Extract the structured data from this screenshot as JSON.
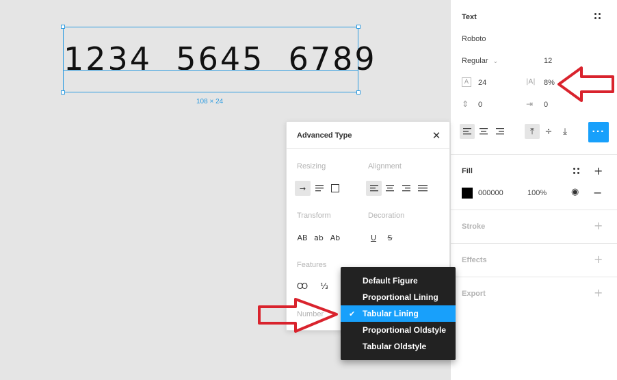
{
  "canvas": {
    "sample_text": "1234  5645  6789",
    "size_label": "108 × 24"
  },
  "text_section": {
    "title": "Text",
    "font_family": "Roboto",
    "font_style": "Regular",
    "font_size": "12",
    "line_height": "24",
    "letter_spacing": "8%",
    "paragraph_spacing": "0",
    "paragraph_indent": "0"
  },
  "fill_section": {
    "title": "Fill",
    "hex": "000000",
    "opacity": "100%"
  },
  "stroke_section": {
    "title": "Stroke"
  },
  "effects_section": {
    "title": "Effects"
  },
  "export_section": {
    "title": "Export"
  },
  "advanced_type": {
    "title": "Advanced Type",
    "resizing_label": "Resizing",
    "alignment_label": "Alignment",
    "transform_label": "Transform",
    "decoration_label": "Decoration",
    "features_label": "Features",
    "numbers_label": "Number",
    "transform_options": [
      "AB",
      "ab",
      "Ab"
    ]
  },
  "number_dropdown": {
    "options": [
      {
        "label": "Default Figure",
        "selected": false
      },
      {
        "label": "Proportional Lining",
        "selected": false
      },
      {
        "label": "Tabular Lining",
        "selected": true
      },
      {
        "label": "Proportional Oldstyle",
        "selected": false
      },
      {
        "label": "Tabular Oldstyle",
        "selected": false
      }
    ]
  },
  "colors": {
    "accent": "#18a0fb",
    "selection": "#2a9ae0",
    "annotation_arrow": "#d9232d",
    "dropdown_bg": "#222222"
  }
}
